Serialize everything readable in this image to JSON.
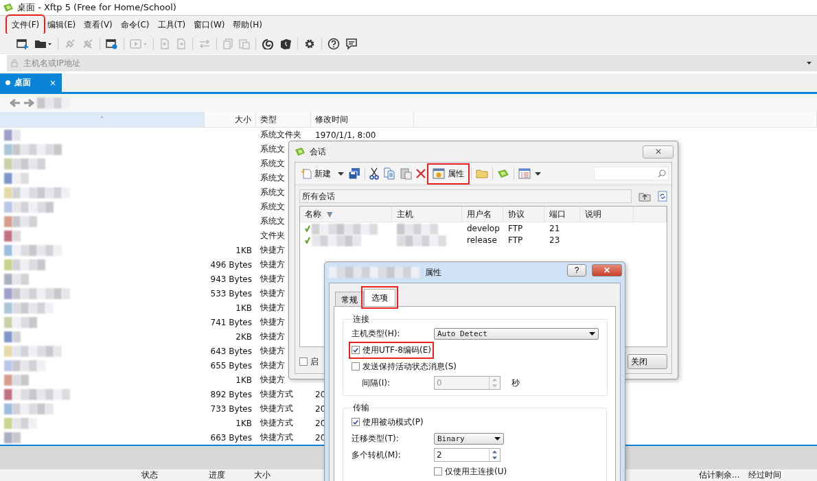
{
  "window": {
    "title": "桌面 - Xftp 5 (Free for Home/School)"
  },
  "menu": [
    {
      "label": "文件(F)",
      "highlighted": true
    },
    {
      "label": "编辑(E)",
      "highlighted": false
    },
    {
      "label": "查看(V)",
      "highlighted": false
    },
    {
      "label": "命令(C)",
      "highlighted": false
    },
    {
      "label": "工具(T)",
      "highlighted": false
    },
    {
      "label": "窗口(W)",
      "highlighted": false
    },
    {
      "label": "帮助(H)",
      "highlighted": false
    }
  ],
  "address_bar": {
    "placeholder": "主机名或IP地址"
  },
  "tabs": [
    {
      "label": "桌面",
      "selected": true,
      "close": "×"
    }
  ],
  "file_list": {
    "columns": [
      {
        "sort": "˄"
      },
      {
        "label": "大小"
      },
      {
        "label": "类型"
      },
      {
        "label": "修改时间"
      }
    ],
    "rows": [
      {
        "type": "系统文件夹",
        "modified": "1970/1/1, 8:00"
      },
      {
        "type": "系统文"
      },
      {
        "type": "系统文"
      },
      {
        "type": "系统文"
      },
      {
        "type": "系统文"
      },
      {
        "type": "系统文"
      },
      {
        "type": "系统文"
      },
      {
        "type": "文件夹"
      },
      {
        "size": "1KB",
        "type": "快捷方"
      },
      {
        "size": "496 Bytes",
        "type": "快捷方"
      },
      {
        "size": "943 Bytes",
        "type": "快捷方"
      },
      {
        "size": "533 Bytes",
        "type": "快捷方"
      },
      {
        "size": "1KB",
        "type": "快捷方"
      },
      {
        "size": "741 Bytes",
        "type": "快捷方"
      },
      {
        "size": "2KB",
        "type": "快捷方"
      },
      {
        "size": "643 Bytes",
        "type": "快捷方"
      },
      {
        "size": "655 Bytes",
        "type": "快捷方"
      },
      {
        "size": "1KB",
        "type": "快捷方"
      },
      {
        "size": "892 Bytes",
        "type": "快捷方式",
        "modified": "20"
      },
      {
        "size": "733 Bytes",
        "type": "快捷方式",
        "modified": "20"
      },
      {
        "size": "1KB",
        "type": "快捷方式",
        "modified": "20"
      },
      {
        "size": "663 Bytes",
        "type": "快捷方式",
        "modified": "20"
      }
    ]
  },
  "transfer_list": {
    "columns": [
      "状态",
      "进度",
      "大小",
      "估计剩余...",
      "经过时间"
    ]
  },
  "session_dialog": {
    "title": "会话",
    "close": "✕",
    "new_label": "新建",
    "properties": {
      "label": "属性",
      "highlighted": true
    },
    "path": "所有会话",
    "columns": [
      {
        "label": "名称",
        "sort": "▼"
      },
      {
        "label": "主机"
      },
      {
        "label": "用户名"
      },
      {
        "label": "协议"
      },
      {
        "label": "端口"
      },
      {
        "label": "说明"
      }
    ],
    "rows": [
      {
        "user": "develop",
        "protocol": "FTP",
        "port": "21"
      },
      {
        "user": "release",
        "protocol": "FTP",
        "port": "23"
      }
    ],
    "startup": {
      "label": "启",
      "checked": false
    },
    "close_button": "关闭"
  },
  "properties_dialog": {
    "title": "属性",
    "help": "?",
    "close": "✕",
    "tabs": [
      {
        "label": "常规",
        "selected": false,
        "highlighted": false
      },
      {
        "label": "选项",
        "selected": true,
        "highlighted": true
      }
    ],
    "groups": [
      {
        "title": "连接",
        "fields": [
          {
            "kind": "select",
            "label": "主机类型(H):",
            "value": "Auto Detect"
          },
          {
            "kind": "checkbox",
            "label": "使用UTF-8编码(E)",
            "checked": true,
            "highlighted": true
          },
          {
            "kind": "checkbox",
            "label": "发送保持活动状态消息(S)",
            "checked": false
          },
          {
            "kind": "spin",
            "label": "间隔(I):",
            "value": "0",
            "disabled": true,
            "unit": "秒"
          }
        ]
      },
      {
        "title": "传输",
        "fields": [
          {
            "kind": "checkbox",
            "label": "使用被动模式(P)",
            "checked": true
          },
          {
            "kind": "select",
            "label": "迁移类型(T):",
            "value": "Binary"
          },
          {
            "kind": "spin",
            "label": "多个转机(M):",
            "value": "2",
            "disabled": false
          },
          {
            "kind": "subcheckbox",
            "label": "仅使用主连接(U)",
            "checked": false
          }
        ]
      }
    ]
  }
}
